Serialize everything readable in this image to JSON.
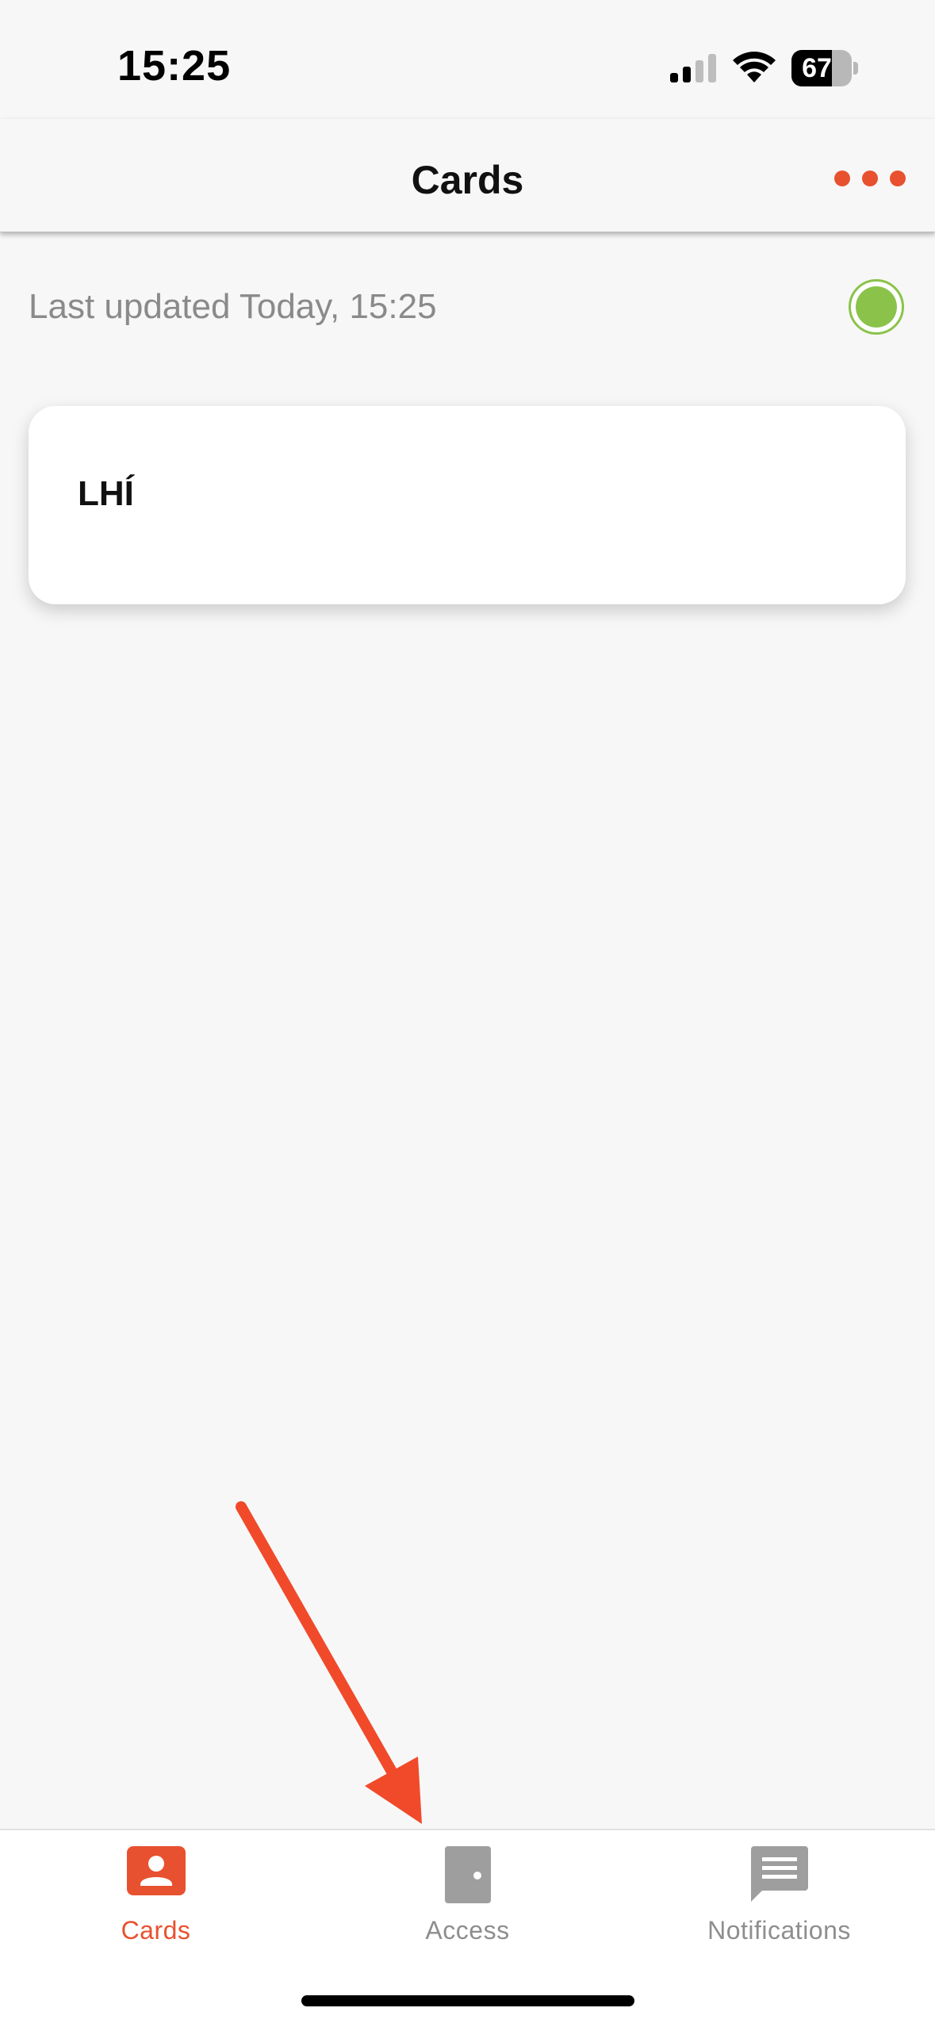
{
  "status_bar": {
    "time": "15:25",
    "battery_level": "67",
    "battery_fraction": 0.67
  },
  "nav": {
    "title": "Cards",
    "more_icon": "more-horizontal-icon"
  },
  "last_updated": {
    "text": "Last updated Today, 15:25",
    "status_color": "#8bc34a"
  },
  "cards": [
    {
      "title": "LHÍ"
    }
  ],
  "annotation": {
    "color": "#f04a2a",
    "points_to": "tab-access"
  },
  "tabs": [
    {
      "label": "Cards",
      "icon": "person-card-icon",
      "active": true
    },
    {
      "label": "Access",
      "icon": "door-icon",
      "active": false
    },
    {
      "label": "Notifications",
      "icon": "message-icon",
      "active": false
    }
  ],
  "colors": {
    "accent": "#e8512f",
    "inactive": "#8e8e8e",
    "background": "#f7f7f7"
  }
}
